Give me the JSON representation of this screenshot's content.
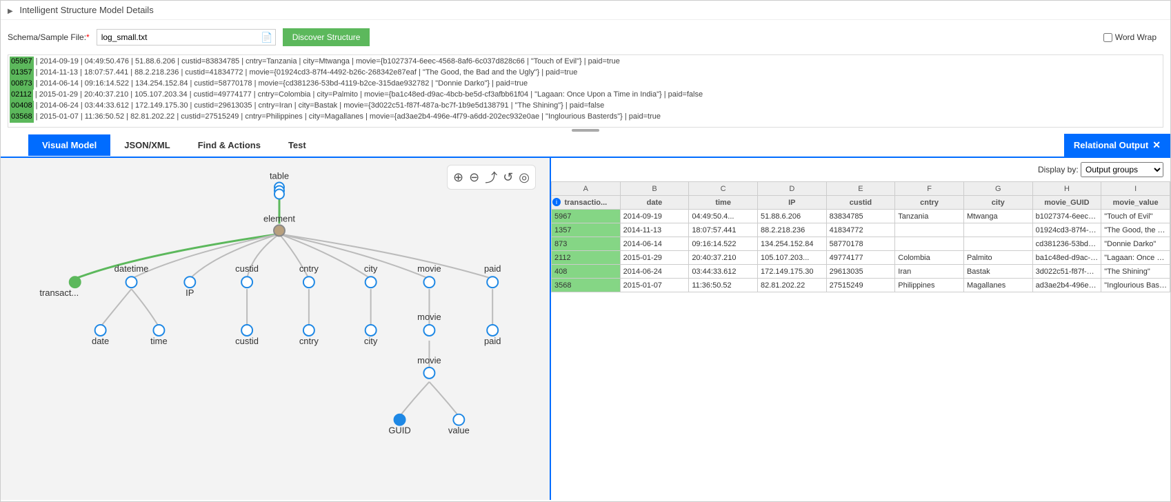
{
  "header": {
    "title": "Intelligent Structure Model Details"
  },
  "file": {
    "label": "Schema/Sample File:",
    "value": "log_small.txt",
    "discover_label": "Discover Structure",
    "word_wrap_label": "Word Wrap"
  },
  "log_lines": [
    {
      "id": "05967",
      "rest": " | 2014-09-19 | 04:49:50.476 | 51.88.6.206 | custid=83834785 | cntry=Tanzania | city=Mtwanga | movie={b1027374-6eec-4568-8af6-6c037d828c66 | \"Touch of Evil\"} | paid=true"
    },
    {
      "id": "01357",
      "rest": " | 2014-11-13 | 18:07:57.441 | 88.2.218.236 | custid=41834772 | movie={01924cd3-87f4-4492-b26c-268342e87eaf | \"The Good, the Bad and the Ugly\"} | paid=true"
    },
    {
      "id": "00873",
      "rest": " | 2014-06-14 | 09:16:14.522 | 134.254.152.84 | custid=58770178 | movie={cd381236-53bd-4119-b2ce-315dae932782 | \"Donnie Darko\"} | paid=true"
    },
    {
      "id": "02112",
      "rest": " | 2015-01-29 | 20:40:37.210 | 105.107.203.34 | custid=49774177 | cntry=Colombia | city=Palmito | movie={ba1c48ed-d9ac-4bcb-be5d-cf3afbb61f04 | \"Lagaan: Once Upon a Time in India\"} | paid=false"
    },
    {
      "id": "00408",
      "rest": " | 2014-06-24 | 03:44:33.612 | 172.149.175.30 | custid=29613035 | cntry=Iran | city=Bastak | movie={3d022c51-f87f-487a-bc7f-1b9e5d138791 | \"The Shining\"} | paid=false"
    },
    {
      "id": "03568",
      "rest": " | 2015-01-07 | 11:36:50.52 | 82.81.202.22 | custid=27515249 | cntry=Philippines | city=Magallanes | movie={ad3ae2b4-496e-4f79-a6dd-202ec932e0ae | \"Inglourious Basterds\"} | paid=true"
    }
  ],
  "tabs": {
    "t1": "Visual Model",
    "t2": "JSON/XML",
    "t3": "Find & Actions",
    "t4": "Test",
    "relational": "Relational Output"
  },
  "tree": {
    "root": "table",
    "element": "element",
    "leaves": [
      "transact...",
      "datetime",
      "IP",
      "custid",
      "cntry",
      "city",
      "movie",
      "paid"
    ],
    "sub_datetime": [
      "date",
      "time"
    ],
    "sub_custid": "custid",
    "sub_cntry": "cntry",
    "sub_city": "city",
    "sub_paid": "paid",
    "sub_movie1": "movie",
    "sub_movie2": "movie",
    "sub_guid": "GUID",
    "sub_value": "value"
  },
  "right": {
    "display_by_label": "Display by:",
    "display_by_value": "Output groups",
    "col_letters": [
      "A",
      "B",
      "C",
      "D",
      "E",
      "F",
      "G",
      "H",
      "I"
    ],
    "headers": [
      "transactio...",
      "date",
      "time",
      "IP",
      "custid",
      "cntry",
      "city",
      "movie_GUID",
      "movie_value"
    ],
    "rows": [
      {
        "id": "5967",
        "date": "2014-09-19",
        "time": "04:49:50.4...",
        "ip": "51.88.6.206",
        "custid": "83834785",
        "cntry": "Tanzania",
        "city": "Mtwanga",
        "guid": "b1027374-6eec-4568-8af6-6c037...",
        "val": "\"Touch of Evil\""
      },
      {
        "id": "1357",
        "date": "2014-11-13",
        "time": "18:07:57.441",
        "ip": "88.2.218.236",
        "custid": "41834772",
        "cntry": "",
        "city": "",
        "guid": "01924cd3-87f4-4492-b26c-26834...",
        "val": "\"The Good, the Bad and the Ug"
      },
      {
        "id": "873",
        "date": "2014-06-14",
        "time": "09:16:14.522",
        "ip": "134.254.152.84",
        "custid": "58770178",
        "cntry": "",
        "city": "",
        "guid": "cd381236-53bd-4119-b2ce-315dae...",
        "val": "\"Donnie Darko\""
      },
      {
        "id": "2112",
        "date": "2015-01-29",
        "time": "20:40:37.210",
        "ip": "105.107.203...",
        "custid": "49774177",
        "cntry": "Colombia",
        "city": "Palmito",
        "guid": "ba1c48ed-d9ac-4bcb-be5d-cf3afb...",
        "val": "\"Lagaan: Once Upon a Time in"
      },
      {
        "id": "408",
        "date": "2014-06-24",
        "time": "03:44:33.612",
        "ip": "172.149.175.30",
        "custid": "29613035",
        "cntry": "Iran",
        "city": "Bastak",
        "guid": "3d022c51-f87f-487a-bc7f-1b9e5d...",
        "val": "\"The Shining\""
      },
      {
        "id": "3568",
        "date": "2015-01-07",
        "time": "11:36:50.52",
        "ip": "82.81.202.22",
        "custid": "27515249",
        "cntry": "Philippines",
        "city": "Magallanes",
        "guid": "ad3ae2b4-496e-4f79-a6dd-202ec...",
        "val": "\"Inglourious Basterds\""
      }
    ]
  }
}
